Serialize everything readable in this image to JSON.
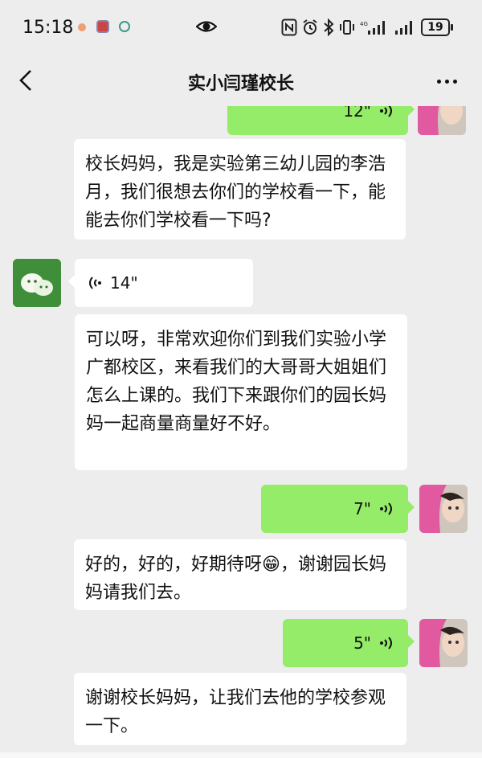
{
  "status_bar": {
    "time": "15:18",
    "battery": "19",
    "signal_text": "ıl ıl"
  },
  "header": {
    "title": "实小闫瑾校长"
  },
  "messages": [
    {
      "side": "right",
      "type": "voice",
      "duration": "12\""
    },
    {
      "side": "transcript",
      "text": "校长妈妈，我是实验第三幼儿园的李浩月，我们很想去你们的学校看一下，能能去你们学校看一下吗?"
    },
    {
      "side": "left",
      "type": "voice",
      "duration": "14\""
    },
    {
      "side": "transcript",
      "text": "可以呀，非常欢迎你们到我们实验小学广都校区，来看我们的大哥哥大姐姐们怎么上课的。我们下来跟你们的园长妈妈一起商量商量好不好。"
    },
    {
      "side": "right",
      "type": "voice",
      "duration": "7\""
    },
    {
      "side": "transcript",
      "text_before": "好的，好的，好期待呀",
      "text_after": "，谢谢园长妈妈请我们去。",
      "emoji": "😁"
    },
    {
      "side": "right",
      "type": "voice",
      "duration": "5\""
    },
    {
      "side": "transcript",
      "text": "谢谢校长妈妈，让我们去他的学校参观一下。"
    }
  ],
  "colors": {
    "background": "#ededed",
    "outgoing_bubble": "#95ec69",
    "incoming_bubble": "#ffffff",
    "status_dot_1": "#f0a070",
    "status_dot_2": "#d04a4a",
    "status_dot_3": "#3a9a8a"
  },
  "icons": [
    "back-arrow-icon",
    "more-dots-icon",
    "eye-icon",
    "nfc-icon",
    "alarm-icon",
    "bluetooth-icon",
    "vibrate-icon",
    "signal-icon",
    "battery-icon",
    "voice-wave-icon",
    "wechat-avatar-icon",
    "emoji-grin-icon"
  ]
}
